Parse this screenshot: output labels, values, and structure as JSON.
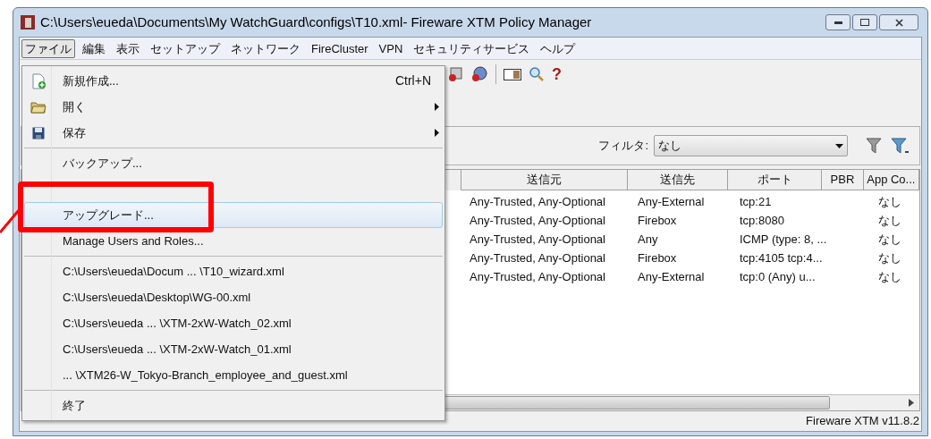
{
  "window": {
    "title": "C:\\Users\\eueda\\Documents\\My WatchGuard\\configs\\T10.xml- Fireware XTM Policy Manager"
  },
  "menubar": [
    {
      "label": "ファイル",
      "selected": true
    },
    {
      "label": "編集",
      "selected": false
    },
    {
      "label": "表示",
      "selected": false
    },
    {
      "label": "セットアップ",
      "selected": false
    },
    {
      "label": "ネットワーク",
      "selected": false
    },
    {
      "label": "FireCluster",
      "selected": false
    },
    {
      "label": "VPN",
      "selected": false
    },
    {
      "label": "セキュリティサービス",
      "selected": false
    },
    {
      "label": "ヘルプ",
      "selected": false
    }
  ],
  "file_menu": {
    "groups": [
      [
        {
          "label": "新規作成...",
          "shortcut": "Ctrl+N",
          "submenu": false,
          "highlighted": false
        },
        {
          "label": "開く",
          "submenu": true,
          "highlighted": false
        },
        {
          "label": "保存",
          "submenu": true,
          "highlighted": false
        }
      ],
      [
        {
          "label": "バックアップ...",
          "submenu": false,
          "highlighted": false
        },
        {
          "label": "アップグレード...",
          "submenu": false,
          "highlighted": true
        },
        {
          "label": "Manage Users and Roles...",
          "submenu": false,
          "highlighted": false
        }
      ],
      [
        {
          "label": "C:\\Users\\eueda\\Docum ... \\T10_wizard.xml",
          "submenu": false,
          "highlighted": false
        },
        {
          "label": "C:\\Users\\eueda\\Desktop\\WG-00.xml",
          "submenu": false,
          "highlighted": false
        },
        {
          "label": "C:\\Users\\eueda ... \\XTM-2xW-Watch_02.xml",
          "submenu": false,
          "highlighted": false
        },
        {
          "label": "C:\\Users\\eueda ... \\XTM-2xW-Watch_01.xml",
          "submenu": false,
          "highlighted": false
        },
        {
          "label": " ... \\XTM26-W_Tokyo-Branch_employee_and_guest.xml",
          "submenu": false,
          "highlighted": false
        }
      ],
      [
        {
          "label": "終了",
          "submenu": false,
          "highlighted": false
        }
      ]
    ]
  },
  "toolbar": {
    "help_label": "?"
  },
  "filter": {
    "label": "フィルタ:",
    "value": "なし"
  },
  "table": {
    "columns": [
      "送信元",
      "送信先",
      "ポート",
      "PBR",
      "App Co..."
    ],
    "rows": [
      {
        "source": "Any-Trusted, Any-Optional",
        "destination": "Any-External",
        "port": "tcp:21",
        "app_control": "なし"
      },
      {
        "source": "Any-Trusted, Any-Optional",
        "destination": "Firebox",
        "port": "tcp:8080",
        "app_control": "なし"
      },
      {
        "source": "Any-Trusted, Any-Optional",
        "destination": "Any",
        "port": "ICMP (type: 8, ...",
        "app_control": "なし"
      },
      {
        "source": "Any-Trusted, Any-Optional",
        "destination": "Firebox",
        "port": "tcp:4105 tcp:4...",
        "app_control": "なし"
      },
      {
        "source": "Any-Trusted, Any-Optional",
        "destination": "Any-External",
        "port": "tcp:0 (Any) u...",
        "app_control": "なし"
      }
    ]
  },
  "status_bar": {
    "text": "Fireware XTM v11.8.2"
  }
}
